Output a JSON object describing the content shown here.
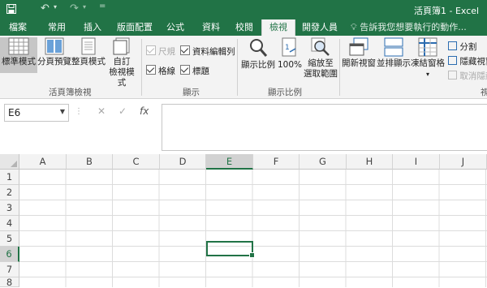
{
  "titlebar": {
    "title": "活頁簿1 - Excel"
  },
  "tabs": [
    {
      "label": "檔案"
    },
    {
      "label": "常用"
    },
    {
      "label": "插入"
    },
    {
      "label": "版面配置"
    },
    {
      "label": "公式"
    },
    {
      "label": "資料"
    },
    {
      "label": "校閱"
    },
    {
      "label": "檢視",
      "active": true
    },
    {
      "label": "開發人員"
    }
  ],
  "tell_me": "告訴我您想要執行的動作...",
  "ribbon": {
    "views_group": {
      "label": "活頁簿檢視",
      "normal": "標準模式",
      "page_break": "分頁預覽",
      "page_layout": "整頁模式",
      "custom_views_1": "自訂",
      "custom_views_2": "檢視模式"
    },
    "show_group": {
      "label": "顯示",
      "ruler": "尺規",
      "formula_bar": "資料編輯列",
      "gridlines": "格線",
      "headings": "標題"
    },
    "zoom_group": {
      "label": "顯示比例",
      "zoom": "顯示比例",
      "zoom100": "100%",
      "zoom_sel_1": "縮放至",
      "zoom_sel_2": "選取範圍"
    },
    "window_group": {
      "new_window": "開新視窗",
      "arrange_all": "並排顯示",
      "freeze_panes": "凍結窗格",
      "split": "分割",
      "hide": "隱藏視窗",
      "unhide": "取消隱藏",
      "label_partial": "視"
    }
  },
  "formula_bar": {
    "name_box": "E6",
    "fx": "fx",
    "value": ""
  },
  "columns": [
    "A",
    "B",
    "C",
    "D",
    "E",
    "F",
    "G",
    "H",
    "I",
    "J"
  ],
  "rows": [
    "1",
    "2",
    "3",
    "4",
    "5",
    "6",
    "7",
    "8"
  ],
  "selected": {
    "column": "E",
    "row": "6"
  },
  "colors": {
    "accent": "#217346"
  }
}
